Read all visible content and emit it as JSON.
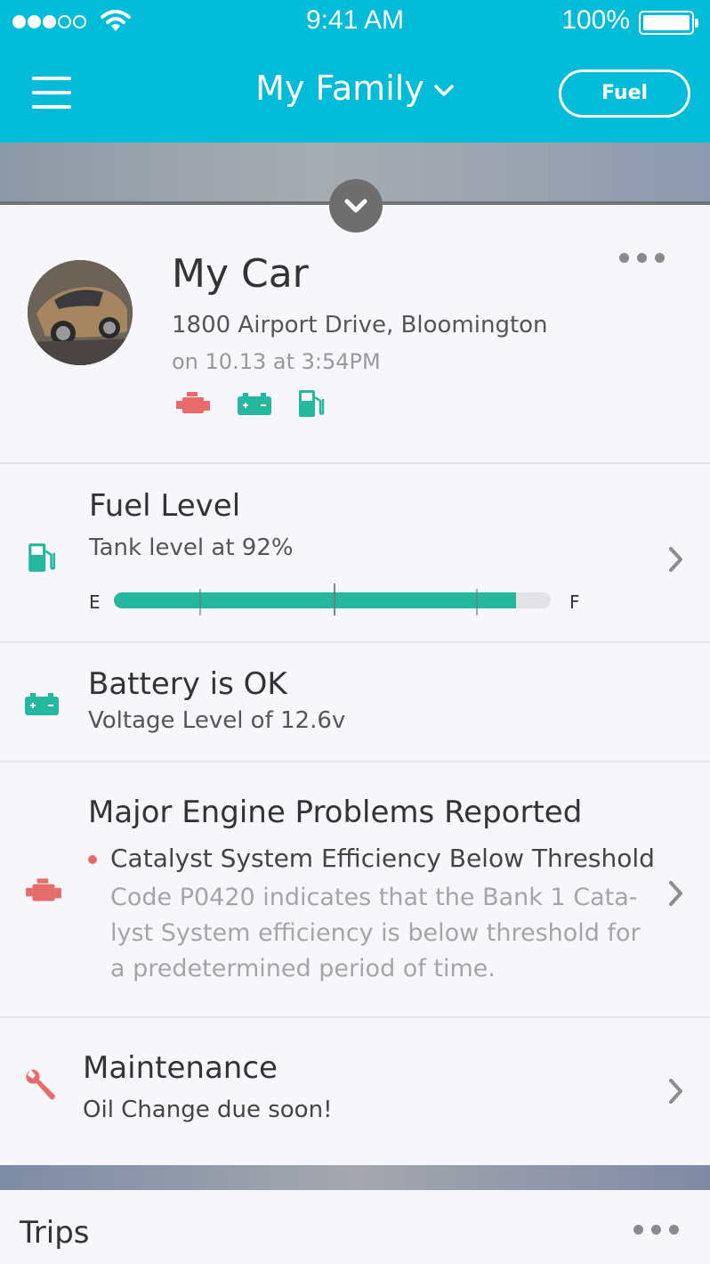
{
  "status_bar": {
    "time": "9:41 AM",
    "battery": "100%"
  },
  "nav": {
    "title": "My Family",
    "fuel_button": "Fuel"
  },
  "car": {
    "name": "My Car",
    "address": "1800 Airport Drive, Bloomington",
    "timestamp": "on 10.13 at 3:54PM",
    "status_icons": [
      {
        "icon": "engine-icon",
        "color": "#e66b6b"
      },
      {
        "icon": "battery-icon",
        "color": "#26b89f"
      },
      {
        "icon": "fuel-pump-icon",
        "color": "#26b89f"
      }
    ]
  },
  "fuel": {
    "title": "Fuel Level",
    "subtitle": "Tank level at 92%",
    "level": 0.92,
    "empty_label": "E",
    "full_label": "F"
  },
  "battery": {
    "title": "Battery is OK",
    "subtitle": "Voltage Level of 12.6v"
  },
  "engine": {
    "title": "Major Engine Problems Reported",
    "code_title": "Catalyst System Efficiency Below Threshold",
    "code_description_lines": [
      "Code P0420 indicates that the Bank 1 Cata-",
      "lyst System efficiency is below threshold for",
      "a predetermined period of time."
    ]
  },
  "maintenance": {
    "title": "Maintenance",
    "subtitle": "Oil Change due soon!"
  },
  "trips": {
    "title": "Trips"
  },
  "colors": {
    "brand": "#00bcd9",
    "ok": "#26b89f",
    "alert": "#e66b6b"
  }
}
